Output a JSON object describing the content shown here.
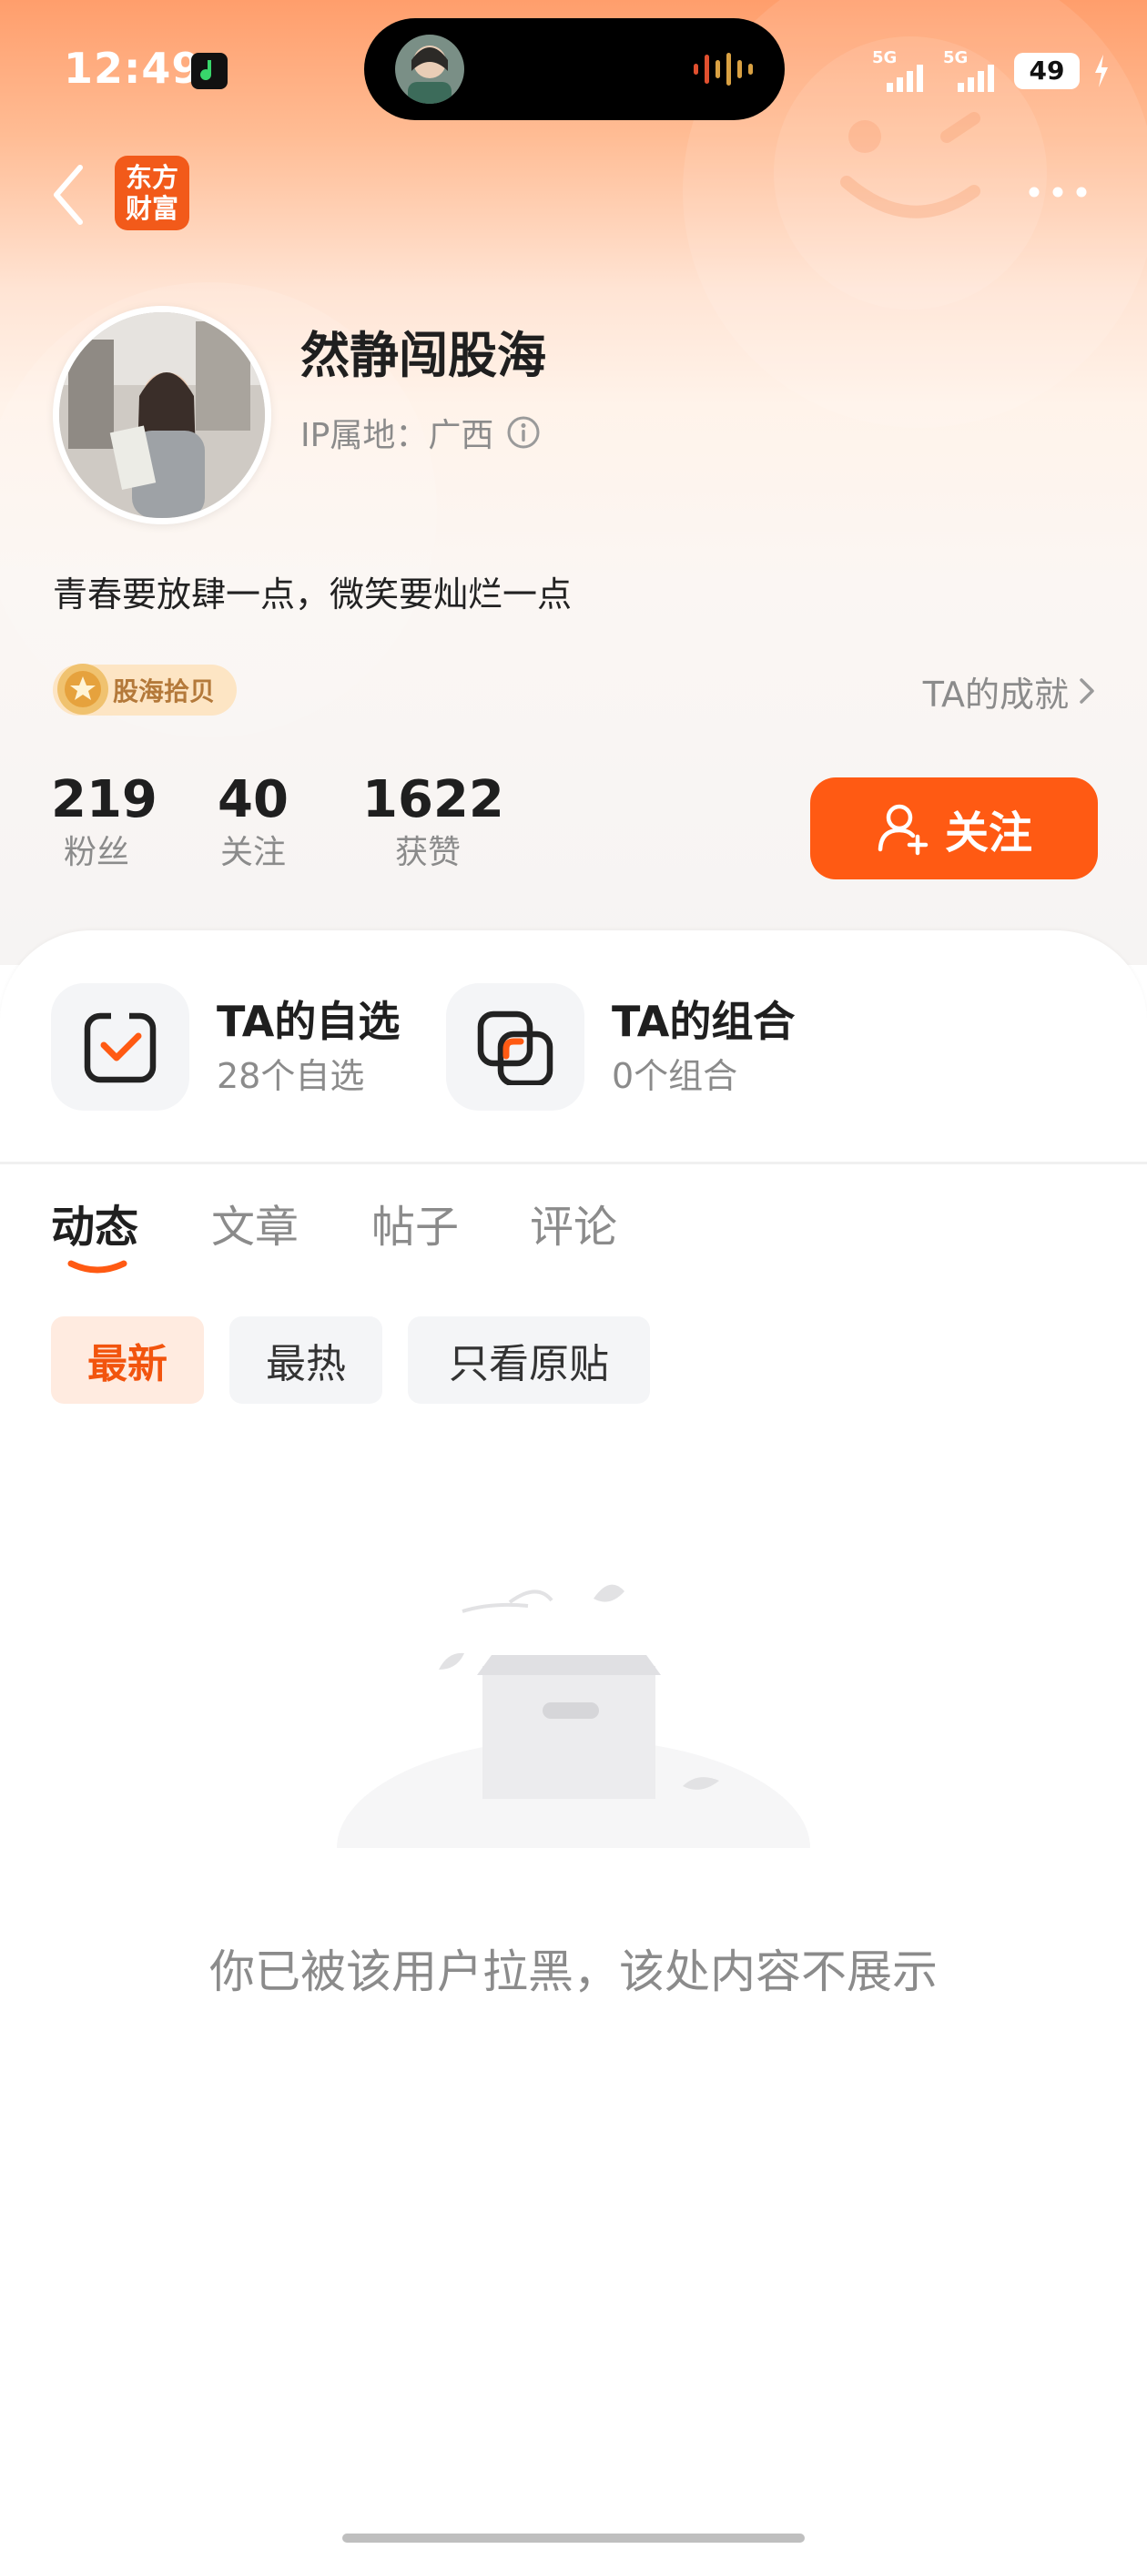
{
  "status_bar": {
    "time": "12:49",
    "signal_1_label": "5G",
    "signal_2_label": "5G",
    "battery": "49"
  },
  "nav": {
    "logo_line1": "东方",
    "logo_line2": "财富"
  },
  "profile": {
    "username": "然静闯股海",
    "ip_location": "IP属地：广西",
    "bio": "青春要放肆一点，微笑要灿烂一点",
    "badge": "股海拾贝",
    "achievements_link": "TA的成就"
  },
  "stats": [
    {
      "value": "219",
      "label": "粉丝"
    },
    {
      "value": "40",
      "label": "关注"
    },
    {
      "value": "1622",
      "label": "获赞"
    }
  ],
  "follow_button": "关注",
  "shortcuts": [
    {
      "title": "TA的自选",
      "subtitle": "28个自选",
      "icon": "watchlist-check-icon"
    },
    {
      "title": "TA的组合",
      "subtitle": "0个组合",
      "icon": "portfolio-combo-icon"
    }
  ],
  "tabs": [
    "动态",
    "文章",
    "帖子",
    "评论"
  ],
  "active_tab": "动态",
  "filters": [
    "最新",
    "最热",
    "只看原贴"
  ],
  "active_filter": "最新",
  "empty_message": "你已被该用户拉黑，该处内容不展示",
  "colors": {
    "accent": "#ff5a13",
    "accent_light": "#ffebe0",
    "badge_bg": "#fde5c4",
    "muted_text": "#8b8b8b"
  }
}
